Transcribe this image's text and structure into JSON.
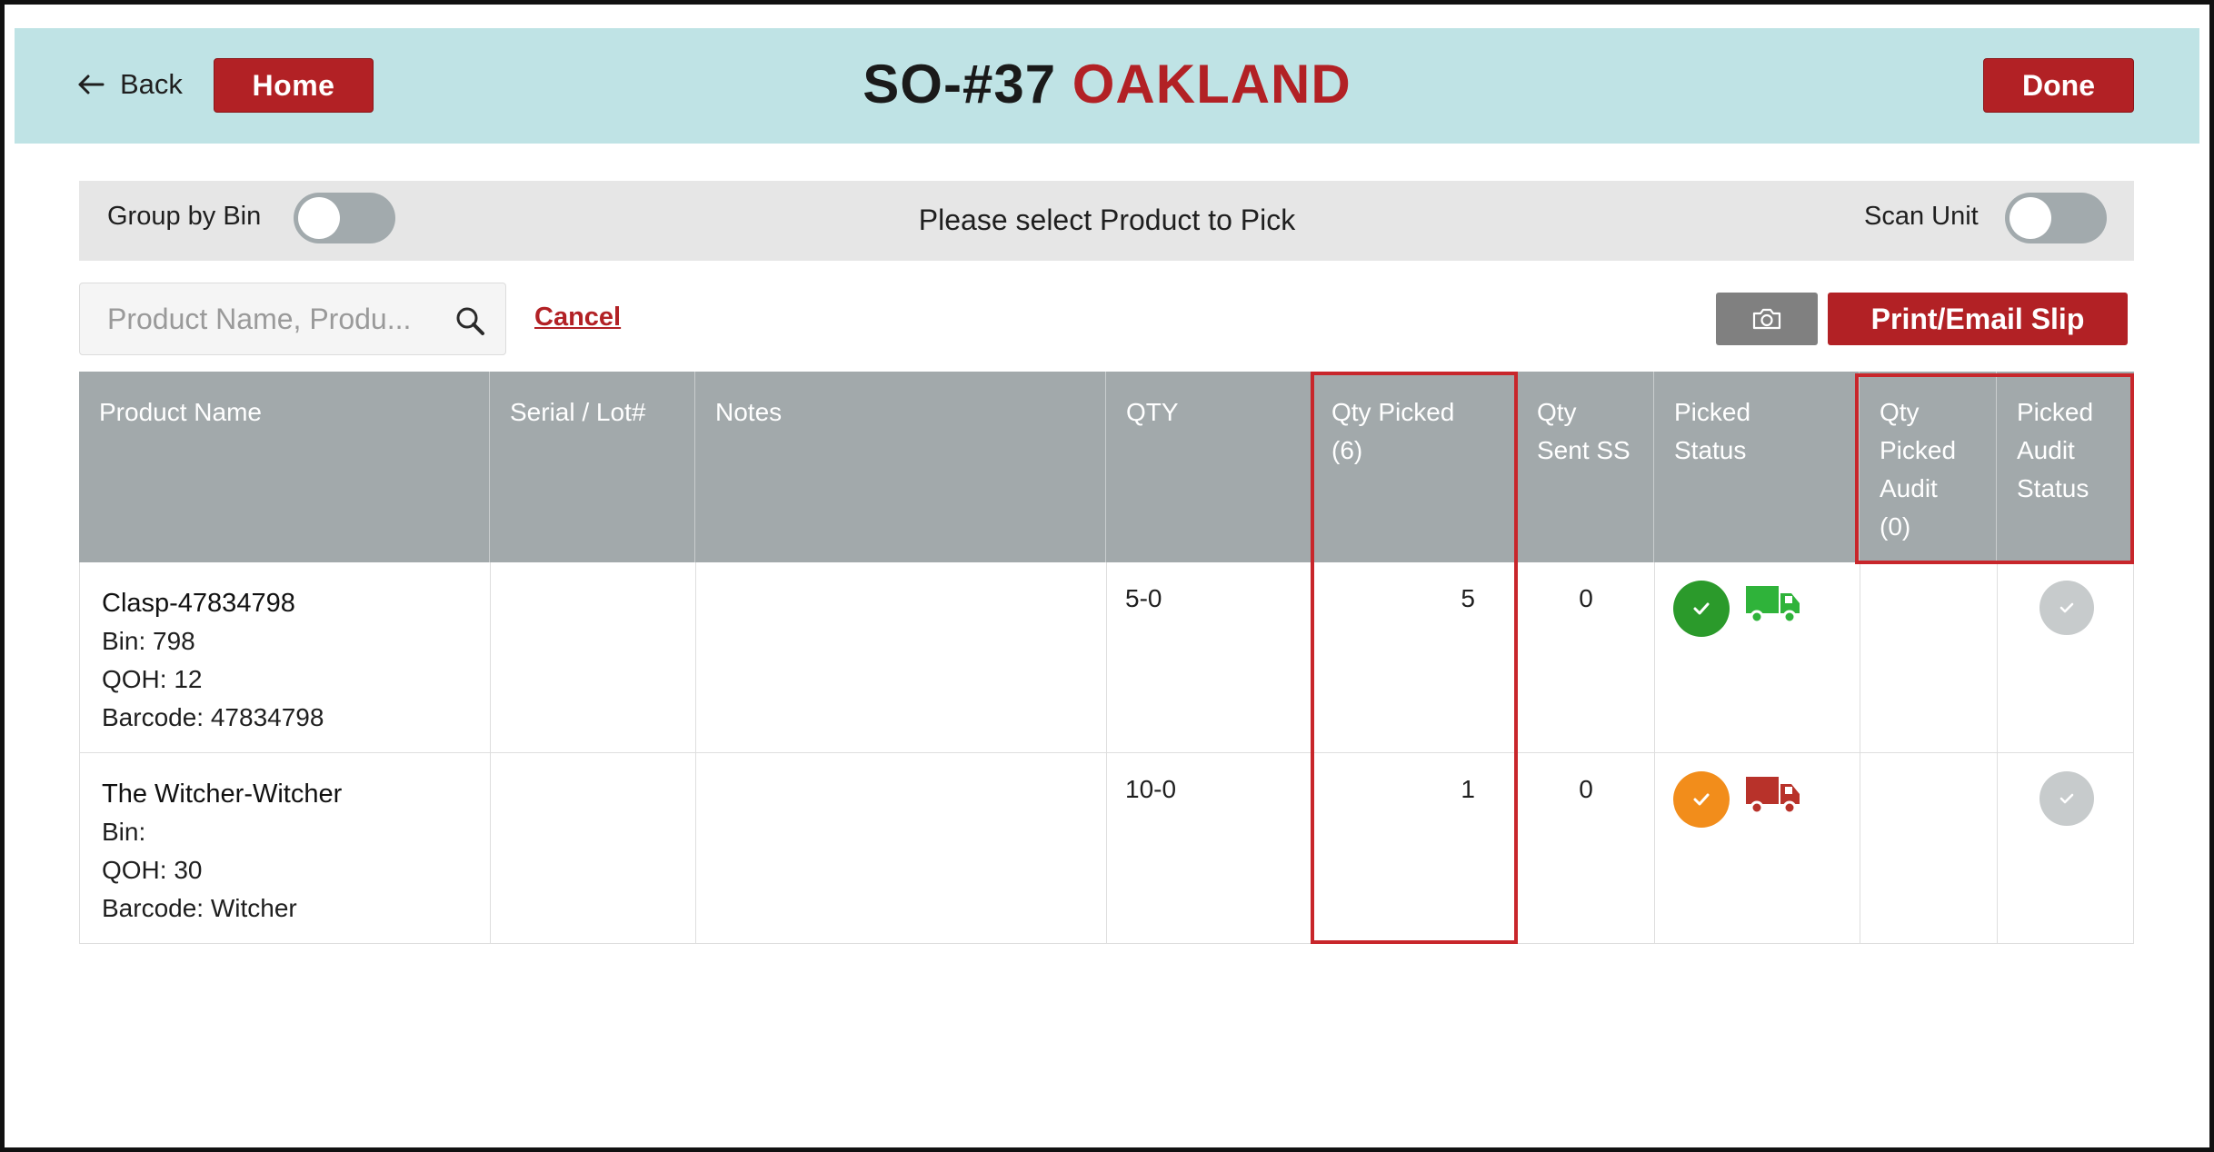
{
  "header": {
    "back_label": "Back",
    "home_label": "Home",
    "order_number": "SO-#37",
    "location": "OAKLAND",
    "done_label": "Done"
  },
  "toolbar": {
    "group_by_bin_label": "Group by Bin",
    "group_by_bin_on": false,
    "prompt": "Please select Product to Pick",
    "scan_unit_label": "Scan Unit",
    "scan_unit_on": false
  },
  "search": {
    "placeholder": "Product Name, Produ...",
    "value": "",
    "cancel_label": "Cancel",
    "print_label": "Print/Email Slip"
  },
  "table": {
    "columns": {
      "product_name": "Product Name",
      "serial_lot": "Serial / Lot#",
      "notes": "Notes",
      "qty": "QTY",
      "qty_picked": [
        "Qty Picked",
        "(6)"
      ],
      "qty_sent_ss": [
        "Qty",
        "Sent SS"
      ],
      "picked_status": [
        "Picked",
        "Status"
      ],
      "qty_picked_audit": [
        "Qty",
        "Picked",
        "Audit",
        "(0)"
      ],
      "picked_audit_status": [
        "Picked",
        "Audit",
        "Status"
      ]
    },
    "rows": [
      {
        "name": "Clasp-47834798",
        "bin": "Bin: 798",
        "qoh": "QOH:  12",
        "barcode": "Barcode: 47834798",
        "serial": "",
        "notes": "",
        "qty": "5-0",
        "qty_picked": "5",
        "qty_sent_ss": "0",
        "status_color": "#2b9a2b",
        "truck_color": "#2fb33a",
        "qty_picked_audit": ""
      },
      {
        "name": "The Witcher-Witcher",
        "bin": "Bin:",
        "qoh": "QOH:  30",
        "barcode": "Barcode: Witcher",
        "serial": "",
        "notes": "",
        "qty": "10-0",
        "qty_picked": "1",
        "qty_sent_ss": "0",
        "status_color": "#f28d1b",
        "truck_color": "#b8322a",
        "qty_picked_audit": ""
      }
    ]
  },
  "icons": {
    "back": "arrow-left-icon",
    "search": "search-icon",
    "camera": "camera-icon",
    "check": "check-icon",
    "truck": "truck-icon"
  },
  "colors": {
    "brand_red": "#b22125",
    "header_bg": "#bfe3e5",
    "table_header_bg": "#a2a9ab",
    "highlight": "#c8262b"
  }
}
